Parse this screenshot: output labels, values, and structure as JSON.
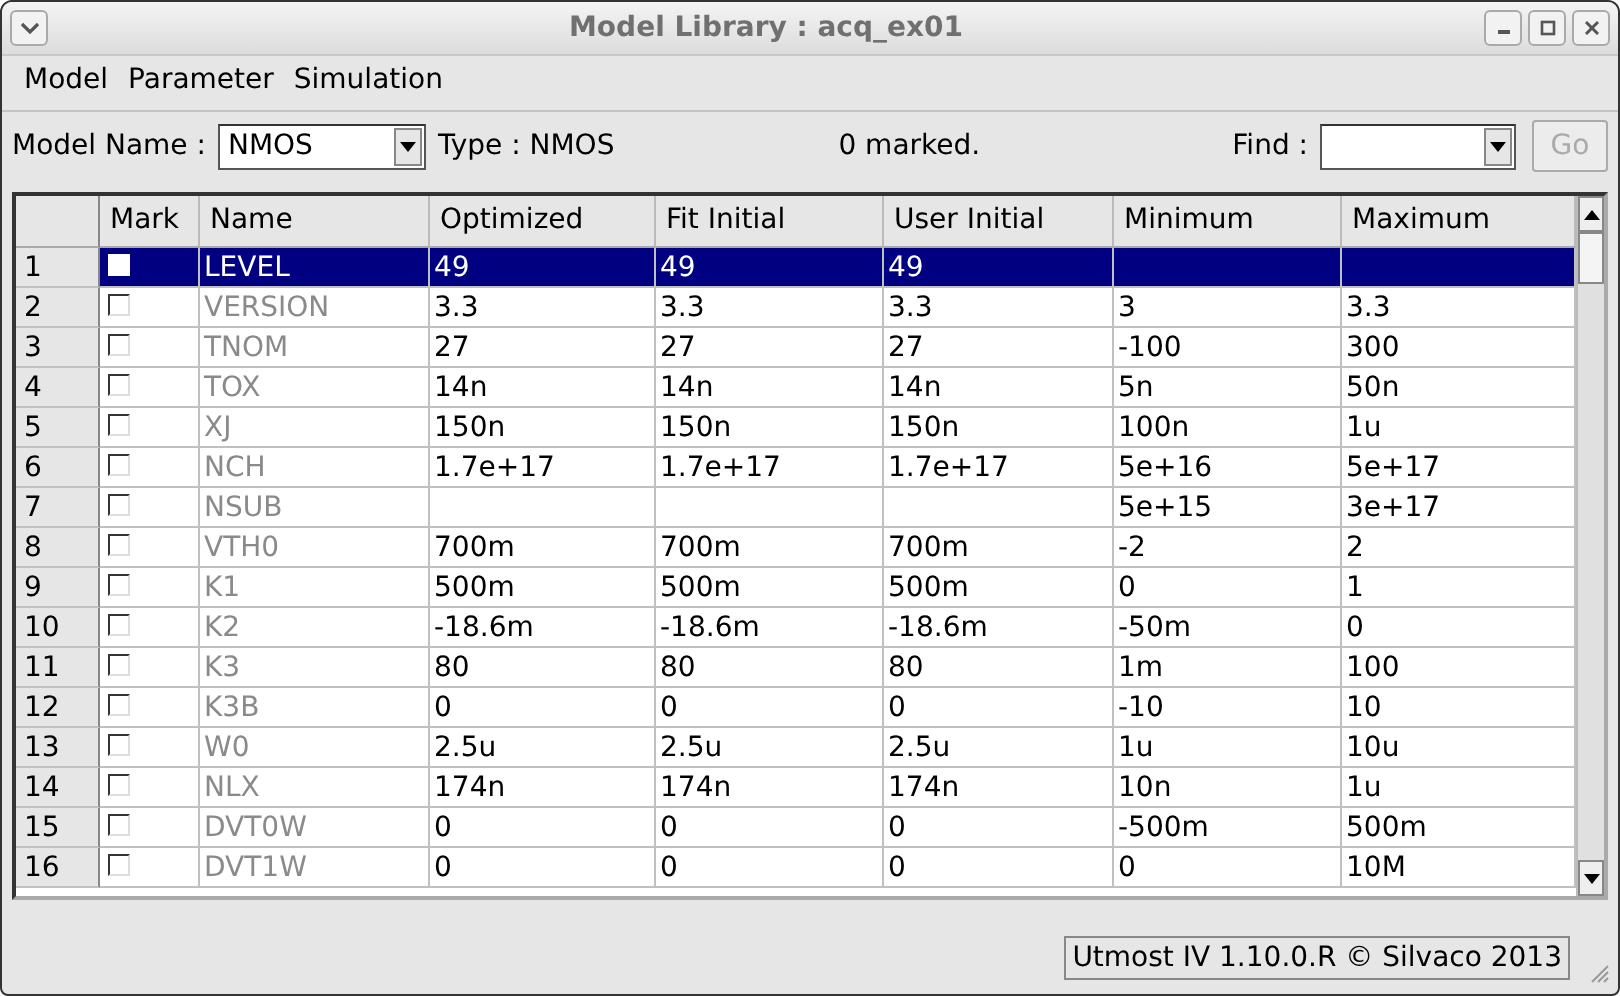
{
  "window": {
    "title": "Model Library : acq_ex01"
  },
  "menu": [
    "Model",
    "Parameter",
    "Simulation"
  ],
  "toolbar": {
    "model_name_label": "Model Name :",
    "model_name": "NMOS",
    "type": "Type : NMOS",
    "marked": "0 marked.",
    "find_label": "Find :",
    "go_button": {
      "label": "Go",
      "disabled": true
    }
  },
  "table": {
    "columns": [
      "Mark",
      "Name",
      "Optimized",
      "Fit Initial",
      "User Initial",
      "Minimum",
      "Maximum"
    ],
    "rows": [
      {
        "num": "1",
        "marked": false,
        "selected": true,
        "name": "LEVEL",
        "optimized": "49",
        "fit_initial": "49",
        "user_initial": "49"
      },
      {
        "num": "2",
        "marked": false,
        "selected": false,
        "name": "VERSION",
        "optimized": "3.3",
        "fit_initial": "3.3",
        "user_initial": "3.3",
        "minimum": "3",
        "maximum": "3.3"
      },
      {
        "num": "3",
        "marked": false,
        "selected": false,
        "name": "TNOM",
        "optimized": "27",
        "fit_initial": "27",
        "user_initial": "27",
        "minimum": "-100",
        "maximum": "300"
      },
      {
        "num": "4",
        "marked": false,
        "selected": false,
        "name": "TOX",
        "optimized": "14n",
        "fit_initial": "14n",
        "user_initial": "14n",
        "minimum": "5n",
        "maximum": "50n"
      },
      {
        "num": "5",
        "marked": false,
        "selected": false,
        "name": "XJ",
        "optimized": "150n",
        "fit_initial": "150n",
        "user_initial": "150n",
        "minimum": "100n",
        "maximum": "1u"
      },
      {
        "num": "6",
        "marked": false,
        "selected": false,
        "name": "NCH",
        "optimized": "1.7e+17",
        "fit_initial": "1.7e+17",
        "user_initial": "1.7e+17",
        "minimum": "5e+16",
        "maximum": "5e+17"
      },
      {
        "num": "7",
        "marked": false,
        "selected": false,
        "name": "NSUB",
        "minimum": "5e+15",
        "maximum": "3e+17"
      },
      {
        "num": "8",
        "marked": false,
        "selected": false,
        "name": "VTH0",
        "optimized": "700m",
        "fit_initial": "700m",
        "user_initial": "700m",
        "minimum": "-2",
        "maximum": "2"
      },
      {
        "num": "9",
        "marked": false,
        "selected": false,
        "name": "K1",
        "optimized": "500m",
        "fit_initial": "500m",
        "user_initial": "500m",
        "minimum": "0",
        "maximum": "1"
      },
      {
        "num": "10",
        "marked": false,
        "selected": false,
        "name": "K2",
        "optimized": "-18.6m",
        "fit_initial": "-18.6m",
        "user_initial": "-18.6m",
        "minimum": "-50m",
        "maximum": "0"
      },
      {
        "num": "11",
        "marked": false,
        "selected": false,
        "name": "K3",
        "optimized": "80",
        "fit_initial": "80",
        "user_initial": "80",
        "minimum": "1m",
        "maximum": "100"
      },
      {
        "num": "12",
        "marked": false,
        "selected": false,
        "name": "K3B",
        "optimized": "0",
        "fit_initial": "0",
        "user_initial": "0",
        "minimum": "-10",
        "maximum": "10"
      },
      {
        "num": "13",
        "marked": false,
        "selected": false,
        "name": "W0",
        "optimized": "2.5u",
        "fit_initial": "2.5u",
        "user_initial": "2.5u",
        "minimum": "1u",
        "maximum": "10u"
      },
      {
        "num": "14",
        "marked": false,
        "selected": false,
        "name": "NLX",
        "optimized": "174n",
        "fit_initial": "174n",
        "user_initial": "174n",
        "minimum": "10n",
        "maximum": "1u"
      },
      {
        "num": "15",
        "marked": false,
        "selected": false,
        "name": "DVT0W",
        "optimized": "0",
        "fit_initial": "0",
        "user_initial": "0",
        "minimum": "-500m",
        "maximum": "500m"
      },
      {
        "num": "16",
        "marked": false,
        "selected": false,
        "name": "DVT1W",
        "optimized": "0",
        "fit_initial": "0",
        "user_initial": "0",
        "minimum": "0",
        "maximum": "10M"
      }
    ]
  },
  "status_bar": "Utmost IV 1.10.0.R © Silvaco 2013"
}
